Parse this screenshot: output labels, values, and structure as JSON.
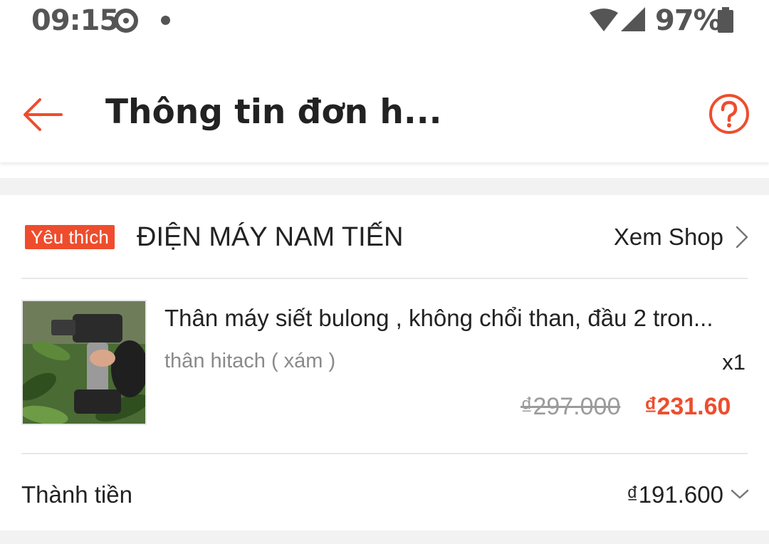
{
  "status_bar": {
    "time": "09:15",
    "battery": "97%"
  },
  "header": {
    "title": "Thông tin đơn h..."
  },
  "shop": {
    "badge": "Yêu thích",
    "name": "ĐIỆN MÁY NAM TIẾN",
    "view_shop": "Xem Shop"
  },
  "product": {
    "name": "Thân máy siết bulong , không chổi than, đầu 2 tron...",
    "variant": "thân hitach ( xám )",
    "quantity": "x1",
    "price_original": "₫297.000",
    "price_sale": "₫231.60"
  },
  "total": {
    "label": "Thành tiền",
    "value": "₫191.600"
  },
  "colors": {
    "accent": "#ee4d2d",
    "text": "#222222",
    "muted": "#8a8a8a",
    "band": "#f2f2f2"
  },
  "icons": [
    "circle-status-icon",
    "wifi-icon",
    "signal-icon",
    "battery-icon",
    "back-arrow-icon",
    "help-icon",
    "chevron-right-icon",
    "chevron-down-icon"
  ]
}
